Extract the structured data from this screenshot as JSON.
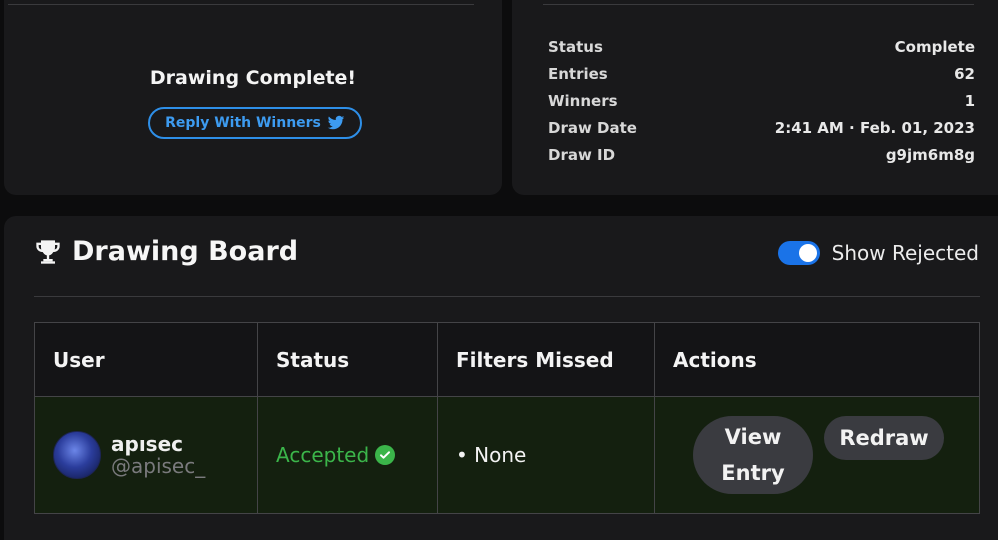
{
  "summary": {
    "title": "Drawing Complete!",
    "reply_button": "Reply With Winners",
    "reply_icon": "twitter-icon"
  },
  "stats": [
    {
      "label": "Status",
      "value": "Complete"
    },
    {
      "label": "Entries",
      "value": "62"
    },
    {
      "label": "Winners",
      "value": "1"
    },
    {
      "label": "Draw Date",
      "value": "2:41 AM · Feb. 01, 2023"
    },
    {
      "label": "Draw ID",
      "value": "g9jm6m8g"
    }
  ],
  "board": {
    "title": "Drawing Board",
    "title_icon": "trophy-icon",
    "toggle_label": "Show Rejected",
    "toggle_on": true,
    "columns": [
      "User",
      "Status",
      "Filters Missed",
      "Actions"
    ],
    "rows": [
      {
        "username": "apısec",
        "handle": "@apisec_",
        "status": "Accepted",
        "filters": "• None",
        "view_line1": "View",
        "view_line2": "Entry",
        "redraw": "Redraw"
      }
    ]
  },
  "colors": {
    "accent_blue": "#2e8fe8",
    "accepted_green": "#3bb54a",
    "row_bg": "#14200f"
  }
}
